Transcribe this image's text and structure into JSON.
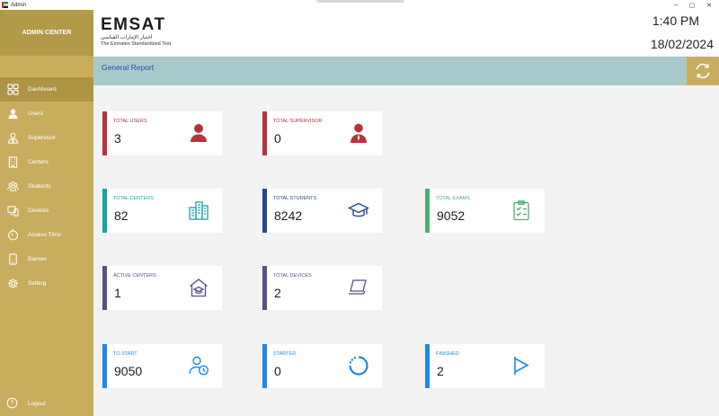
{
  "window": {
    "title": "Admin",
    "minimize": "–",
    "maximize": "▢",
    "close": "✕"
  },
  "sidebar": {
    "brand": "ADMIN CENTER",
    "items": [
      {
        "label": "Dashboard",
        "icon": "dashboard-icon",
        "active": true
      },
      {
        "label": "Users",
        "icon": "user-icon"
      },
      {
        "label": "Supervisor",
        "icon": "supervisor-icon"
      },
      {
        "label": "Centers",
        "icon": "building-icon"
      },
      {
        "label": "Students",
        "icon": "students-icon"
      },
      {
        "label": "Devices",
        "icon": "devices-icon"
      },
      {
        "label": "Access Time",
        "icon": "timer-icon"
      },
      {
        "label": "Banner",
        "icon": "tablet-icon"
      },
      {
        "label": "Setting",
        "icon": "gear-icon"
      }
    ],
    "logout": "Logout"
  },
  "header": {
    "logo": {
      "word": "EMSAT",
      "arabic": "اختبار الإمارات القياسي",
      "sub": "The Emirates Standardized Test"
    },
    "time": "1:40 PM",
    "date": "18/02/2024"
  },
  "report": {
    "title": "General Report"
  },
  "cards": [
    {
      "label": "TOTAL USERS",
      "value": "3",
      "icon": "user-icon",
      "color": "#b5333b"
    },
    {
      "label": "TOTAL SUPERVISOR",
      "value": "0",
      "icon": "supervisor-icon",
      "color": "#b5333b"
    },
    {
      "label": "TOTAL CENTERS",
      "value": "82",
      "icon": "buildings-icon",
      "color": "#17a2a9"
    },
    {
      "label": "TOTAL STUDENTS",
      "value": "8242",
      "icon": "graduation-cap-icon",
      "color": "#1f4a8a"
    },
    {
      "label": "TOTAL EXAMS",
      "value": "9052",
      "icon": "clipboard-icon",
      "color": "#4caf73"
    },
    {
      "label": "ACTIVE CENTERS",
      "value": "1",
      "icon": "school-house-icon",
      "color": "#5a4f86"
    },
    {
      "label": "TOTAL DEVICES",
      "value": "2",
      "icon": "laptop-icon",
      "color": "#5a4f86"
    },
    {
      "label": "TO START",
      "value": "9050",
      "icon": "user-clock-icon",
      "color": "#1e88e5"
    },
    {
      "label": "STARTED",
      "value": "0",
      "icon": "progress-circle-icon",
      "color": "#1e88e5"
    },
    {
      "label": "FINISHED",
      "value": "2",
      "icon": "finish-flag-icon",
      "color": "#1e88e5"
    }
  ]
}
